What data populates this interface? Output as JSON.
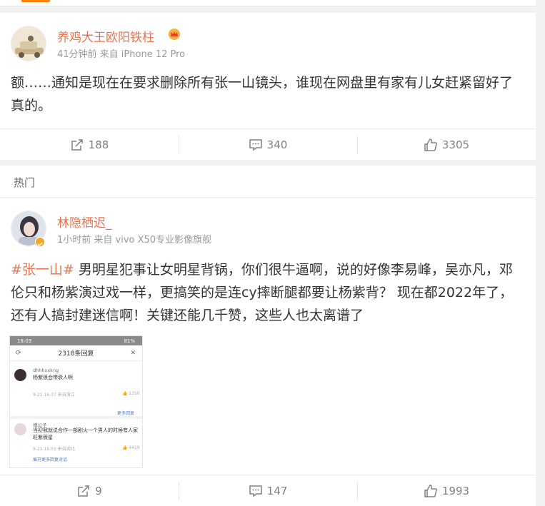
{
  "colors": {
    "accent": "#ff8200",
    "username": "#eb7350",
    "meta": "#999999",
    "action": "#808080"
  },
  "post1": {
    "username": "养鸡大王欧阳铁柱",
    "meta": "41分钟前 来自 iPhone 12 Pro",
    "text": "额……通知是现在在要求删除所有张一山镜头，谁现在网盘里有家有儿女赶紧留好了真的。",
    "badge_icon": "vip-crown-icon",
    "actions": {
      "repost": "188",
      "comment": "340",
      "like": "3305"
    }
  },
  "hot": {
    "label": "热门"
  },
  "post2": {
    "username": "林隐栖迟_",
    "meta": "1小时前 来自 vivo X50专业影像旗舰",
    "topic": "#张一山#",
    "text": " 男明星犯事让女明星背锅，你们很牛逼啊，说的好像李易峰，吴亦凡，邓伦只和杨紫演过戏一样，更搞笑的是连cy摔断腿都要让杨紫背？ 现在都2022年了，还有人搞封建迷信啊！关键还能几千赞，这些人也太离谱了",
    "actions": {
      "repost": "9",
      "comment": "147",
      "like": "1993"
    },
    "screenshot": {
      "status_time": "18:03",
      "status_battery": "81%",
      "title": "2318条回复",
      "c1_name": "dhhhxxkng",
      "c1_text": "杨紫很会带衰人啊",
      "c1_meta": "9-21 16:37 来自浙江",
      "c1_likes": "1350",
      "more_replies": "更多回复",
      "c2_name": "傅公子",
      "c2_text": "当初我就说合作一部剧火一个男人的时候夸人家旺紫薇星",
      "c2_meta": "9-21 16:51 来自湖北",
      "c2_likes": "4419",
      "expand": "展开更多回复对话"
    }
  }
}
